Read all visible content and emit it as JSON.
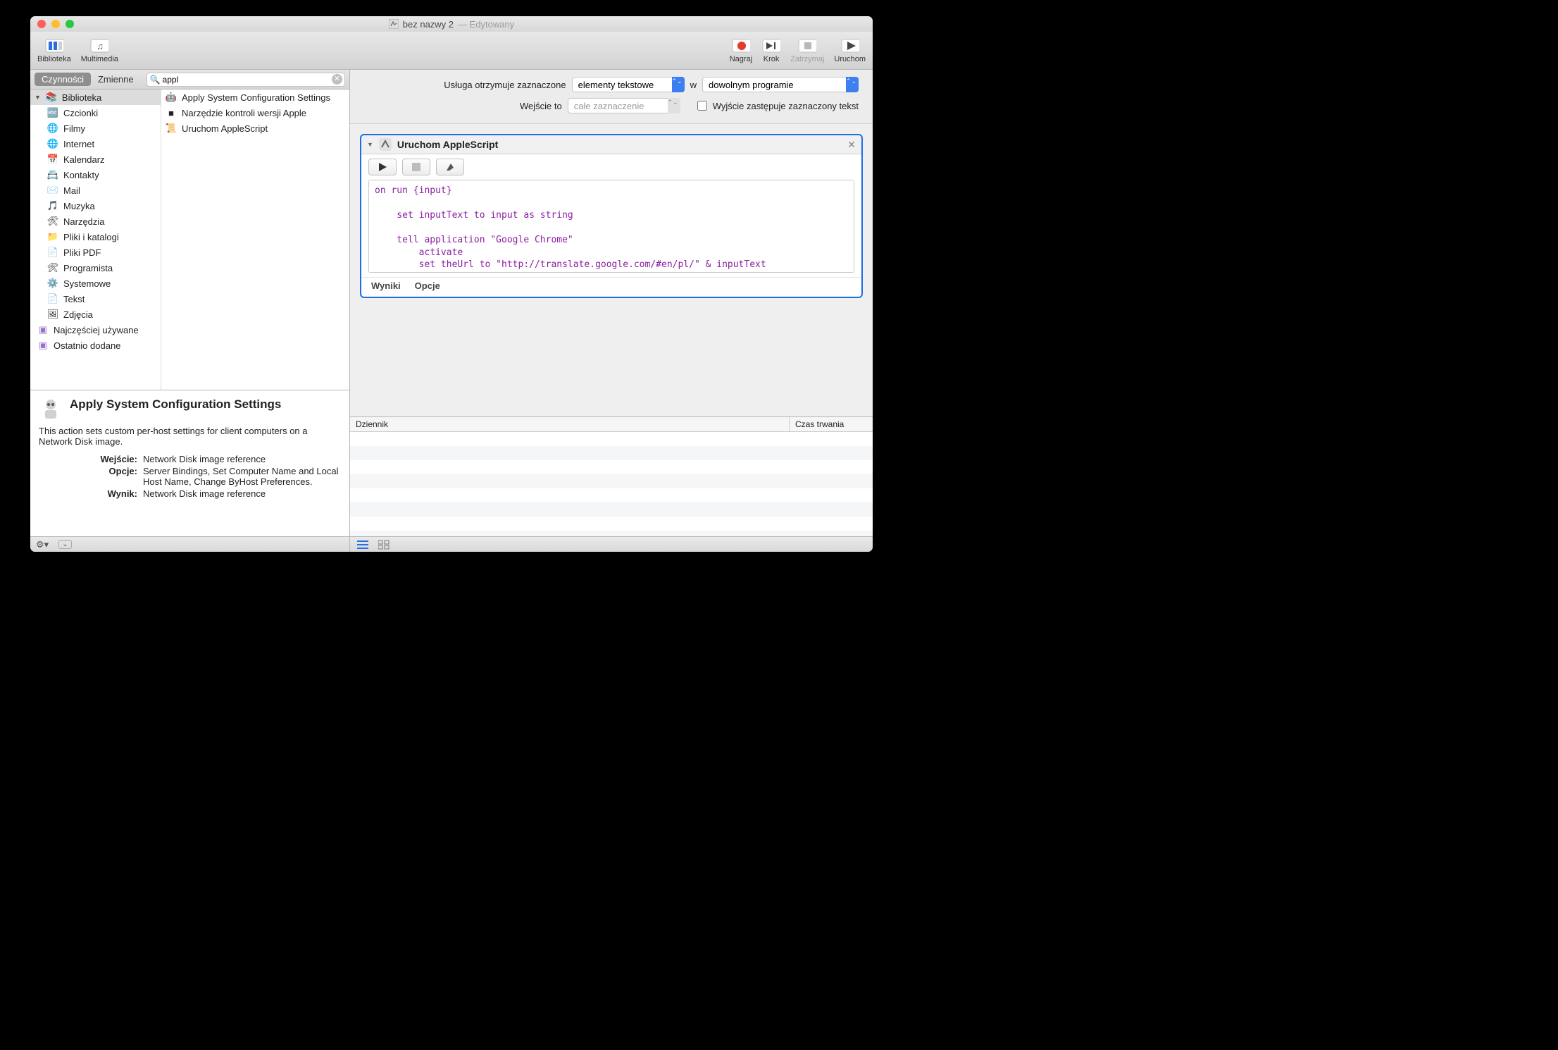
{
  "window": {
    "title": "bez nazwy 2",
    "title_suffix": "— Edytowany"
  },
  "toolbar": {
    "left": [
      {
        "name": "biblioteka",
        "label": "Biblioteka"
      },
      {
        "name": "multimedia",
        "label": "Multimedia"
      }
    ],
    "right": [
      {
        "name": "record",
        "label": "Nagraj",
        "enabled": true
      },
      {
        "name": "step",
        "label": "Krok",
        "enabled": true
      },
      {
        "name": "stop",
        "label": "Zatrzymaj",
        "enabled": false
      },
      {
        "name": "run",
        "label": "Uruchom",
        "enabled": true
      }
    ]
  },
  "left": {
    "tabs": {
      "active": "Czynności",
      "inactive": "Zmienne"
    },
    "search": {
      "value": "appl",
      "placeholder": ""
    },
    "library_root": "Biblioteka",
    "categories": [
      "Czcionki",
      "Filmy",
      "Internet",
      "Kalendarz",
      "Kontakty",
      "Mail",
      "Muzyka",
      "Narzędzia",
      "Pliki i katalogi",
      "Pliki PDF",
      "Programista",
      "Systemowe",
      "Tekst",
      "Zdjęcia"
    ],
    "smart": [
      "Najczęściej używane",
      "Ostatnio dodane"
    ],
    "results": [
      "Apply System Configuration Settings",
      "Narzędzie kontroli wersji Apple",
      "Uruchom AppleScript"
    ],
    "desc": {
      "title": "Apply System Configuration Settings",
      "body": "This action sets custom per-host settings for client computers on a Network Disk image.",
      "rows": [
        {
          "k": "Wejście:",
          "v": "Network Disk image reference"
        },
        {
          "k": "Opcje:",
          "v": "Server Bindings, Set Computer Name and Local Host Name, Change ByHost Preferences."
        },
        {
          "k": "Wynik:",
          "v": "Network Disk image reference"
        }
      ]
    }
  },
  "config": {
    "label_receives": "Usługa otrzymuje zaznaczone",
    "sel_type": "elementy tekstowe",
    "label_in": "w",
    "sel_app": "dowolnym programie",
    "label_input_is": "Wejście to",
    "sel_input": "całe zaznaczenie",
    "chk_label": "Wyjście zastępuje zaznaczony tekst"
  },
  "action": {
    "title": "Uruchom AppleScript",
    "code_lines": [
      "on run {input}",
      "",
      "    set inputText to input as string",
      "",
      "    tell application \"Google Chrome\"",
      "        activate",
      "        set theUrl to \"http://translate.google.com/#en/pl/\" & inputText"
    ],
    "footer": {
      "results": "Wyniki",
      "options": "Opcje"
    }
  },
  "log": {
    "col1": "Dziennik",
    "col2": "Czas trwania"
  }
}
